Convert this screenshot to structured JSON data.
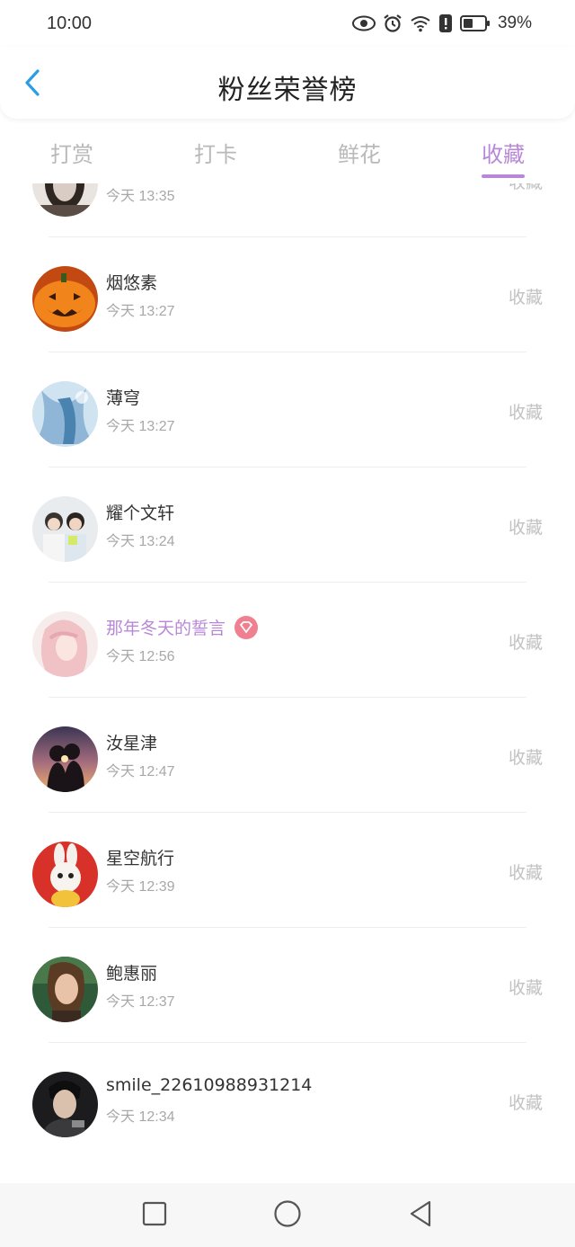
{
  "status": {
    "time": "10:00",
    "battery": "39%"
  },
  "header": {
    "title": "粉丝荣誉榜"
  },
  "tabs": [
    {
      "label": "打赏"
    },
    {
      "label": "打卡"
    },
    {
      "label": "鲜花"
    },
    {
      "label": "收藏",
      "active": true
    }
  ],
  "colors": {
    "accent": "#b888d8",
    "badge": "#f07f8f",
    "muted": "#c2c2c2"
  },
  "fans": [
    {
      "name": "",
      "time": "今天 13:35",
      "action": "收藏",
      "vip": true
    },
    {
      "name": "烟悠素",
      "time": "今天 13:27",
      "action": "收藏"
    },
    {
      "name": "薄穹",
      "time": "今天 13:27",
      "action": "收藏"
    },
    {
      "name": "耀个文轩",
      "time": "今天 13:24",
      "action": "收藏"
    },
    {
      "name": "那年冬天的誓言",
      "time": "今天 12:56",
      "action": "收藏",
      "vip": true
    },
    {
      "name": "汝星津",
      "time": "今天 12:47",
      "action": "收藏"
    },
    {
      "name": "星空航行",
      "time": "今天 12:39",
      "action": "收藏"
    },
    {
      "name": "鲍惠丽",
      "time": "今天 12:37",
      "action": "收藏"
    },
    {
      "name": "smile_22610988931214",
      "time": "今天 12:34",
      "action": "收藏"
    }
  ],
  "icons": {
    "back": "chevron-left-icon",
    "nav_recent": "square-icon",
    "nav_home": "circle-icon",
    "nav_back": "triangle-left-icon"
  }
}
